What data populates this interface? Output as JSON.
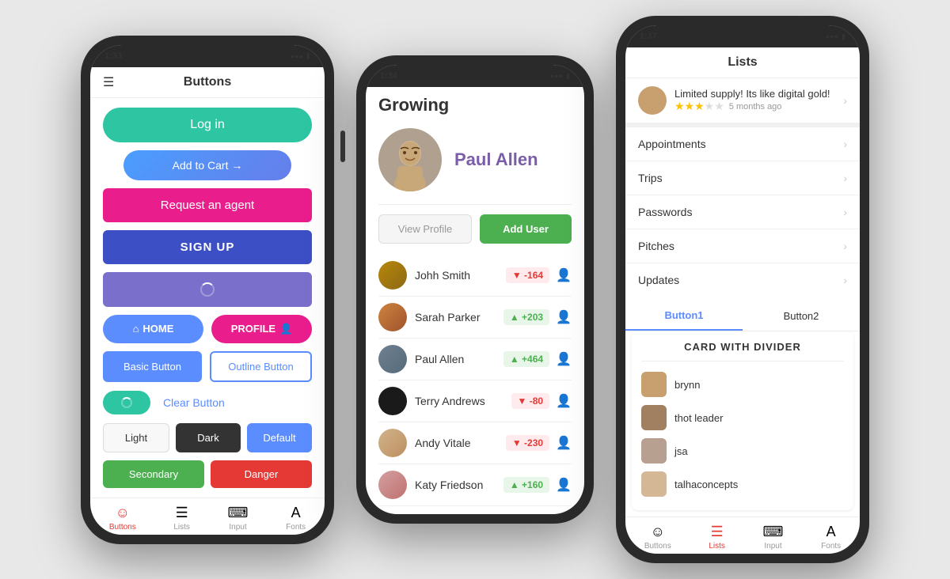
{
  "page": {
    "background": "#e8e8e8"
  },
  "phone1": {
    "time": "1:33",
    "title": "Buttons",
    "buttons": {
      "login": "Log in",
      "addcart": "Add to Cart →",
      "agent": "Request an agent",
      "signup": "SIGN UP",
      "home": "HOME",
      "profile": "PROFILE",
      "basic": "Basic Button",
      "outline": "Outline Button",
      "clear": "Clear Button",
      "light": "Light",
      "dark": "Dark",
      "default": "Default",
      "secondary": "Secondary",
      "danger": "Danger"
    },
    "nav": {
      "buttons": "Buttons",
      "lists": "Lists",
      "input": "Input",
      "fonts": "Fonts"
    }
  },
  "phone2": {
    "time": "1:34",
    "title": "Growing",
    "profile": {
      "name": "Paul Allen",
      "view_profile": "View Profile",
      "add_user": "Add User"
    },
    "users": [
      {
        "name": "Johh Smith",
        "change": "-164",
        "type": "neg"
      },
      {
        "name": "Sarah Parker",
        "change": "+203",
        "type": "pos"
      },
      {
        "name": "Paul Allen",
        "change": "+464",
        "type": "pos"
      },
      {
        "name": "Terry Andrews",
        "change": "-80",
        "type": "neg"
      },
      {
        "name": "Andy Vitale",
        "change": "-230",
        "type": "neg"
      },
      {
        "name": "Katy Friedson",
        "change": "+160",
        "type": "pos"
      }
    ]
  },
  "phone3": {
    "time": "1:37",
    "title": "Lists",
    "featured": {
      "text": "Limited supply! Its like digital gold!",
      "stars": 3,
      "max_stars": 5,
      "meta": "5 months ago"
    },
    "list_items": [
      "Appointments",
      "Trips",
      "Passwords",
      "Pitches",
      "Updates"
    ],
    "tabs": [
      "Button1",
      "Button2"
    ],
    "card": {
      "title": "CARD WITH DIVIDER",
      "users": [
        "brynn",
        "thot leader",
        "jsa",
        "talhaconcepts"
      ]
    },
    "nav": {
      "buttons": "Buttons",
      "lists": "Lists",
      "input": "Input",
      "fonts": "Fonts"
    }
  }
}
